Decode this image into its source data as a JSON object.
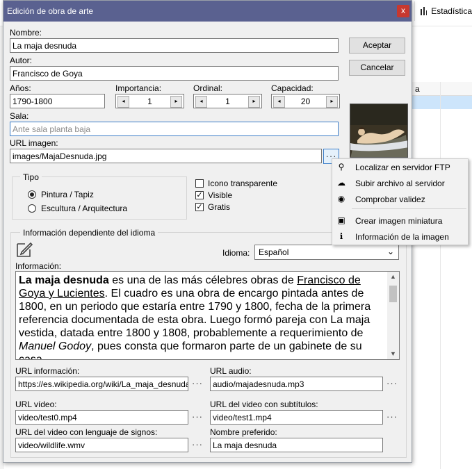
{
  "background": {
    "stats_label": "Estadística",
    "col_header": "a"
  },
  "dialog": {
    "title": "Edición de obra de arte",
    "close_glyph": "x",
    "accept_label": "Aceptar",
    "cancel_label": "Cancelar",
    "nombre_label": "Nombre:",
    "nombre_value": "La maja desnuda",
    "autor_label": "Autor:",
    "autor_value": "Francisco de Goya",
    "anios_label": "Años:",
    "anios_value": "1790-1800",
    "importancia_label": "Importancia:",
    "importancia_value": "1",
    "ordinal_label": "Ordinal:",
    "ordinal_value": "1",
    "capacidad_label": "Capacidad:",
    "capacidad_value": "20",
    "sala_label": "Sala:",
    "sala_placeholder": "Ante sala planta baja",
    "url_imagen_label": "URL imagen:",
    "url_imagen_value": "images/MajaDesnuda.jpg",
    "ellipsis": "···",
    "tipo_label": "Tipo",
    "tipo_options": [
      "Pintura / Tapiz",
      "Escultura / Arquitectura"
    ],
    "tipo_selected": "Pintura / Tapiz",
    "checks": [
      {
        "label": "Icono transparente",
        "checked": false
      },
      {
        "label": "Visible",
        "checked": true
      },
      {
        "label": "Gratis",
        "checked": true
      }
    ],
    "idioma_group_label": "Información dependiente del idioma",
    "idioma_label": "Idioma:",
    "idioma_value": "Español",
    "informacion_label": "Información:",
    "informacion": {
      "bold_title": "La maja desnuda",
      "p1": " es una de las más célebres obras de ",
      "link1": "Francisco de Goya y Lucientes",
      "p2": ". El cuadro es una obra de encargo pintada antes de 1800, en un periodo que estaría entre 1790 y 1800, fecha de la primera referencia documentada de esta obra. Luego formó pareja con La maja vestida, datada entre 1800 y 1808, probablemente a requerimiento de ",
      "italic": "Manuel Godoy",
      "p3": ", pues consta que formaron parte de un gabinete de su ",
      "cut": "casa"
    },
    "url_informacion_label": "URL información:",
    "url_informacion_value": "https://es.wikipedia.org/wiki/La_maja_desnuda",
    "url_audio_label": "URL audio:",
    "url_audio_value": "audio/majadesnuda.mp3",
    "url_video_label": "URL vídeo:",
    "url_video_value": "video/test0.mp4",
    "url_video_sub_label": "URL del video con subtítulos:",
    "url_video_sub_value": "video/test1.mp4",
    "url_video_sign_label": "URL del video con lenguaje de signos:",
    "url_video_sign_value": "video/wildlife.wmv",
    "nombre_pref_label": "Nombre preferido:",
    "nombre_pref_value": "La maja desnuda"
  },
  "context_menu": [
    {
      "label": "Localizar en servidor FTP",
      "icon": "search-icon",
      "glyph": "⚲"
    },
    {
      "label": "Subir archivo al servidor",
      "icon": "cloud-upload-icon",
      "glyph": "☁"
    },
    {
      "label": "Comprobar validez",
      "icon": "eye-icon",
      "glyph": "◉"
    },
    {
      "label": "Crear imagen miniatura",
      "icon": "image-icon",
      "glyph": "▣"
    },
    {
      "label": "Información de la imagen",
      "icon": "info-icon",
      "glyph": "ℹ"
    }
  ],
  "colors": {
    "titlebar": "#5a6190",
    "close": "#c7382f",
    "focus_border": "#3a7cc7"
  }
}
